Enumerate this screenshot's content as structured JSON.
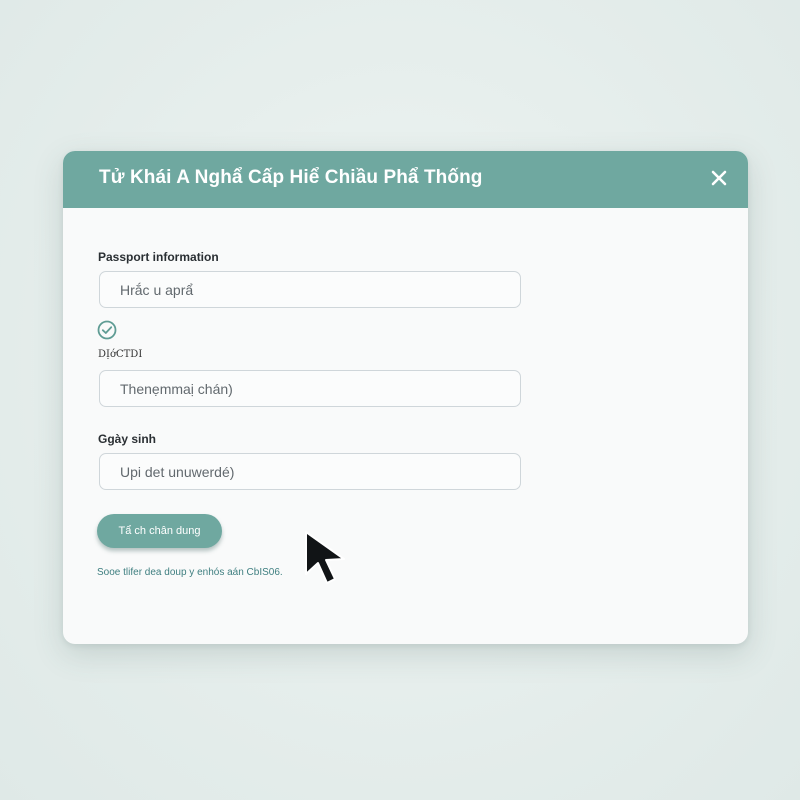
{
  "dialog": {
    "title": "Tử Khái A Nghẩ Cấp Hiể Chiầu Phẩ Thống",
    "close_icon": "close-icon",
    "fields": [
      {
        "label": "Passport information",
        "placeholder": "Hrắc u aprẩ"
      },
      {
        "label": "DỊớCTDI",
        "placeholder": "Thenẹmmaị chán)"
      },
      {
        "label": "Ggày sinh",
        "placeholder": "Upi det unuwerdé)"
      }
    ],
    "check_icon": "check-circle-icon",
    "submit_label": "Tẩ ch chân dung",
    "footnote": "Sooe tlifer dea doup y enhós aán CbIS06."
  },
  "colors": {
    "accent": "#6fa8a0",
    "background": "#e6eeec",
    "card": "#f9fafa",
    "footnote": "#3f7f80"
  },
  "cursor_icon": "mouse-pointer-icon"
}
